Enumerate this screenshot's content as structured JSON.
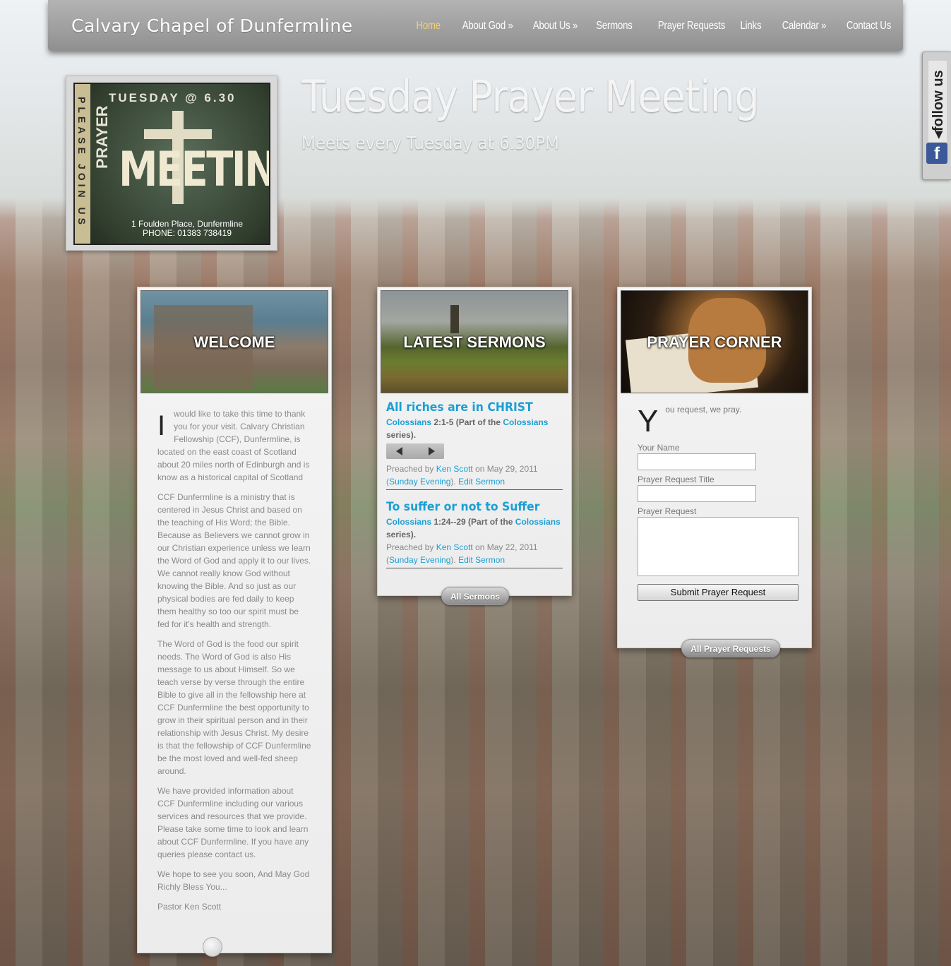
{
  "header": {
    "site_title": "Calvary Chapel of Dunfermline",
    "nav": [
      {
        "label": "Home",
        "active": true
      },
      {
        "label": "About God »"
      },
      {
        "label": "About Us »"
      },
      {
        "label": "Sermons"
      },
      {
        "label": "Prayer Requests"
      },
      {
        "label": "Links"
      },
      {
        "label": "Calendar »"
      },
      {
        "label": "Contact Us"
      }
    ],
    "active_color": "#f2d36b"
  },
  "follow": {
    "label": "◂follow us",
    "facebook_icon": "f"
  },
  "hero": {
    "title": "Tuesday Prayer Meeting",
    "subtitle": "Meets every Tuesday at 6.30PM",
    "poster": {
      "side_text": "PLEASE JOIN US",
      "time": "TUESDAY @ 6.30",
      "prayer": "PRAYER",
      "meeting": "MEETING",
      "address": "1 Foulden Place, Dunfermline",
      "phone": "PHONE: 01383 738419"
    }
  },
  "welcome": {
    "caption": "WELCOME",
    "dropcap": "I",
    "paragraphs": [
      "would like to take this time to thank you for your visit. Calvary Christian Fellowship (CCF), Dunfermline, is located on the east coast of Scotland about 20 miles north of Edinburgh and is know as a historical capital of Scotland",
      "CCF Dunfermline is a ministry that is centered in Jesus Christ and based on the teaching of His Word; the Bible. Because as Believers we cannot grow in our Christian experience unless we learn the Word of God and apply it to our lives. We cannot really know God without knowing the Bible. And so just as our physical bodies are fed daily to keep them healthy so too our spirit must be fed for it's health and strength.",
      "The Word of God is the food our spirit needs. The Word of God is also His message to us about Himself. So we teach verse by verse through the entire Bible to give all in the fellowship here at CCF Dunfermline the best opportunity to grow in their spiritual person and in their relationship with Jesus Christ. My desire is that the fellowship of CCF Dunfermline be the most loved and well-fed sheep around.",
      "We have provided information about CCF Dunfermline including our various services and resources that we provide. Please take some time to look and learn about CCF Dunfermline. If you have any queries please contact us.",
      "We hope to see you soon, And May God Richly Bless You...",
      "Pastor Ken Scott"
    ]
  },
  "sermons": {
    "caption": "LATEST SERMONS",
    "items": [
      {
        "title": "All riches are in CHRIST",
        "book": "Colossians",
        "verses": " 2:1-5 (Part of the ",
        "series": "Colossians",
        "series_tail": " series).",
        "preached_by": "Preached by ",
        "preacher": "Ken Scott",
        "date": " on May 29, 2011",
        "service": "Sunday Evening",
        "edit": "Edit Sermon"
      },
      {
        "title": "To suffer or not to Suffer",
        "book": "Colossians",
        "verses": " 1:24--29 (Part of the ",
        "series": "Colossians",
        "series_tail": " series).",
        "preached_by": "Preached by ",
        "preacher": "Ken Scott",
        "date": " on May 22, 2011",
        "service": "Sunday Evening",
        "edit": "Edit Sermon"
      }
    ],
    "all_button": "All Sermons"
  },
  "prayer": {
    "caption": "PRAYER CORNER",
    "dropcap": "Y",
    "intro": "ou request, we pray.",
    "name_label": "Your Name",
    "title_label": "Prayer Request Title",
    "request_label": "Prayer Request",
    "submit": "Submit Prayer Request",
    "all_button": "All Prayer Requests"
  }
}
